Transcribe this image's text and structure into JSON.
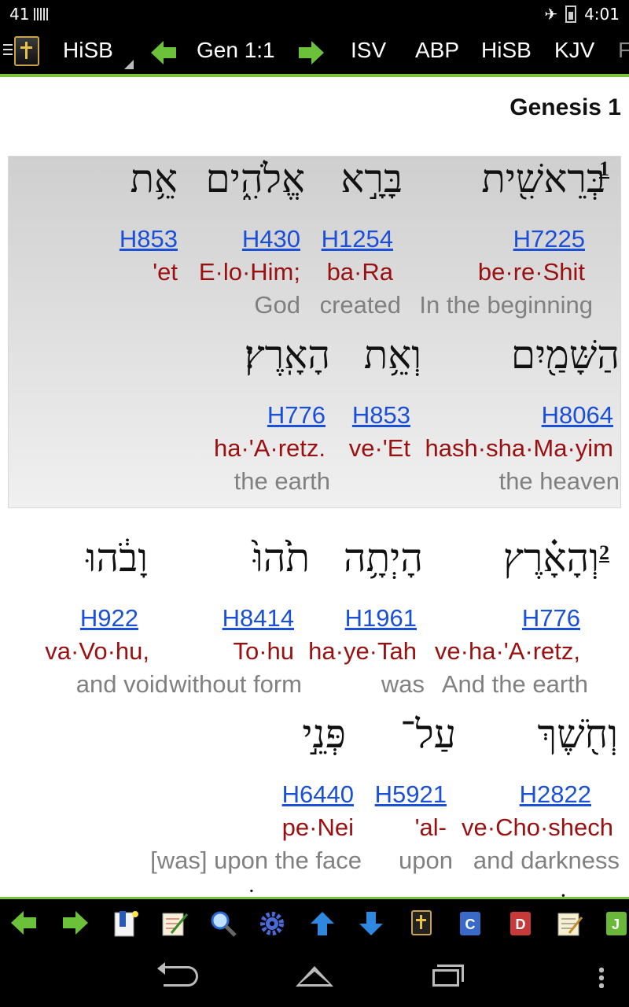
{
  "status": {
    "signal": "41",
    "time": "4:01"
  },
  "toolbar": {
    "module": "HiSB",
    "reference": "Gen 1:1",
    "translations": [
      "ISV",
      "ABP",
      "HiSB",
      "KJV",
      "F"
    ]
  },
  "chapter_title": "Genesis 1",
  "verses": [
    {
      "number": "1",
      "lines": [
        {
          "words": [
            {
              "hebrew": "בְּרֵאשִׁ֖ית",
              "strong": "H7225",
              "translit": "be·re·Shit",
              "gloss": "In the beginning"
            },
            {
              "hebrew": "בָּרָ֣א",
              "strong": "H1254",
              "translit": "ba·Ra",
              "gloss": "created"
            },
            {
              "hebrew": "אֱלֹהִ֑ים",
              "strong": "H430",
              "translit": "E·lo·Him;",
              "gloss": "God"
            },
            {
              "hebrew": "אֵ֥ת",
              "strong": "H853",
              "translit": "'et",
              "gloss": ""
            }
          ]
        },
        {
          "words": [
            {
              "hebrew": "הַשָּׁמַ֖יִם",
              "strong": "H8064",
              "translit": "hash·sha·Ma·yim",
              "gloss": "the heaven"
            },
            {
              "hebrew": "וְאֵ֥ת",
              "strong": "H853",
              "translit": "ve·'Et",
              "gloss": ""
            },
            {
              "hebrew": "הָאָֽרֶץ׃",
              "strong": "H776",
              "translit": "ha·'A·retz.",
              "gloss": "the earth"
            }
          ]
        }
      ]
    },
    {
      "number": "2",
      "lines": [
        {
          "words": [
            {
              "hebrew": "וְהָאָ֗רֶץ",
              "strong": "H776",
              "translit": "ve·ha·'A·retz,",
              "gloss": "And the earth"
            },
            {
              "hebrew": "הָיְתָ֥ה",
              "strong": "H1961",
              "translit": "ha·ye·Tah",
              "gloss": "was"
            },
            {
              "hebrew": "תֹ֙הוּ֙",
              "strong": "H8414",
              "translit": "To·hu",
              "gloss": "without form"
            },
            {
              "hebrew": "וָבֹ֔הוּ",
              "strong": "H922",
              "translit": "va·Vo·hu,",
              "gloss": "and void"
            }
          ]
        },
        {
          "words": [
            {
              "hebrew": "וְחֹ֖שֶׁךְ",
              "strong": "H2822",
              "translit": "ve·Cho·shech",
              "gloss": "and darkness"
            },
            {
              "hebrew": "עַל־",
              "strong": "H5921",
              "translit": "'al-",
              "gloss": "upon"
            },
            {
              "hebrew": "פְּנֵ֣י",
              "strong": "H6440",
              "translit": "pe·Nei",
              "gloss": "[was] upon the face"
            }
          ]
        }
      ]
    }
  ],
  "colors": {
    "accent_green": "#7cc13c",
    "strong_link": "#1a4fd8",
    "translit": "#9a1010",
    "gloss": "#808080"
  },
  "bottom_icons": [
    "prev-arrow-icon",
    "next-arrow-icon",
    "bookmark-icon",
    "notes-icon",
    "search-icon",
    "settings-gear-icon",
    "up-arrow-icon",
    "down-arrow-icon",
    "bible-icon",
    "commentary-icon",
    "dictionary-icon",
    "journal-icon",
    "j-book-icon"
  ]
}
